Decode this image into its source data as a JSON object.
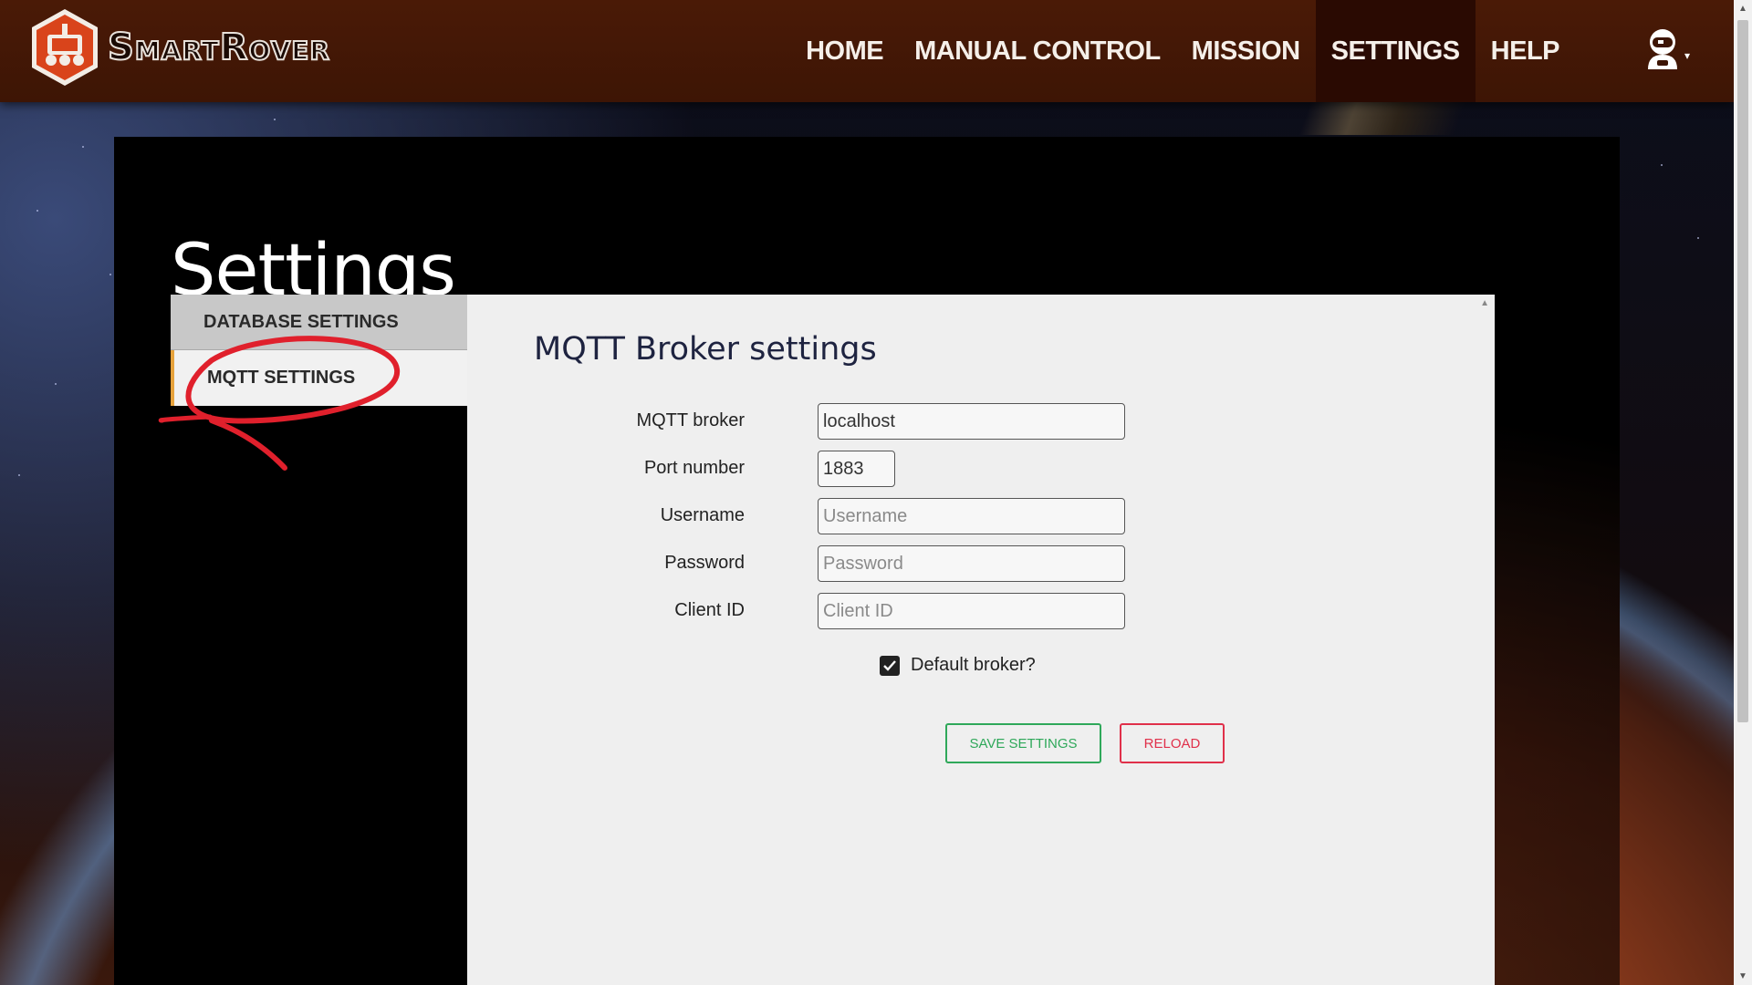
{
  "app": {
    "brand": "SmartRover"
  },
  "nav": {
    "items": [
      {
        "label": "HOME",
        "active": false
      },
      {
        "label": "MANUAL CONTROL",
        "active": false
      },
      {
        "label": "MISSION",
        "active": false
      },
      {
        "label": "SETTINGS",
        "active": true
      },
      {
        "label": "HELP",
        "active": false
      }
    ],
    "user_icon": "astronaut-user-icon"
  },
  "page": {
    "title": "Settings"
  },
  "sidebar": {
    "items": [
      {
        "label": "DATABASE SETTINGS",
        "active": false
      },
      {
        "label": "MQTT SETTINGS",
        "active": true
      }
    ]
  },
  "panel": {
    "title": "MQTT Broker settings",
    "fields": {
      "broker": {
        "label": "MQTT broker",
        "value": "localhost",
        "placeholder": ""
      },
      "port": {
        "label": "Port number",
        "value": "1883",
        "placeholder": ""
      },
      "username": {
        "label": "Username",
        "value": "",
        "placeholder": "Username"
      },
      "password": {
        "label": "Password",
        "value": "",
        "placeholder": "Password"
      },
      "client_id": {
        "label": "Client ID",
        "value": "",
        "placeholder": "Client ID"
      }
    },
    "default_broker": {
      "label": "Default broker?",
      "checked": true
    },
    "buttons": {
      "save": "SAVE SETTINGS",
      "reload": "RELOAD"
    }
  },
  "colors": {
    "topbar": "#3d1505",
    "nav_active": "#2a0a02",
    "save": "#2fa85a",
    "reload": "#e0304a",
    "annotation": "#e0202c",
    "sidebar_accent": "#e6a23c"
  }
}
